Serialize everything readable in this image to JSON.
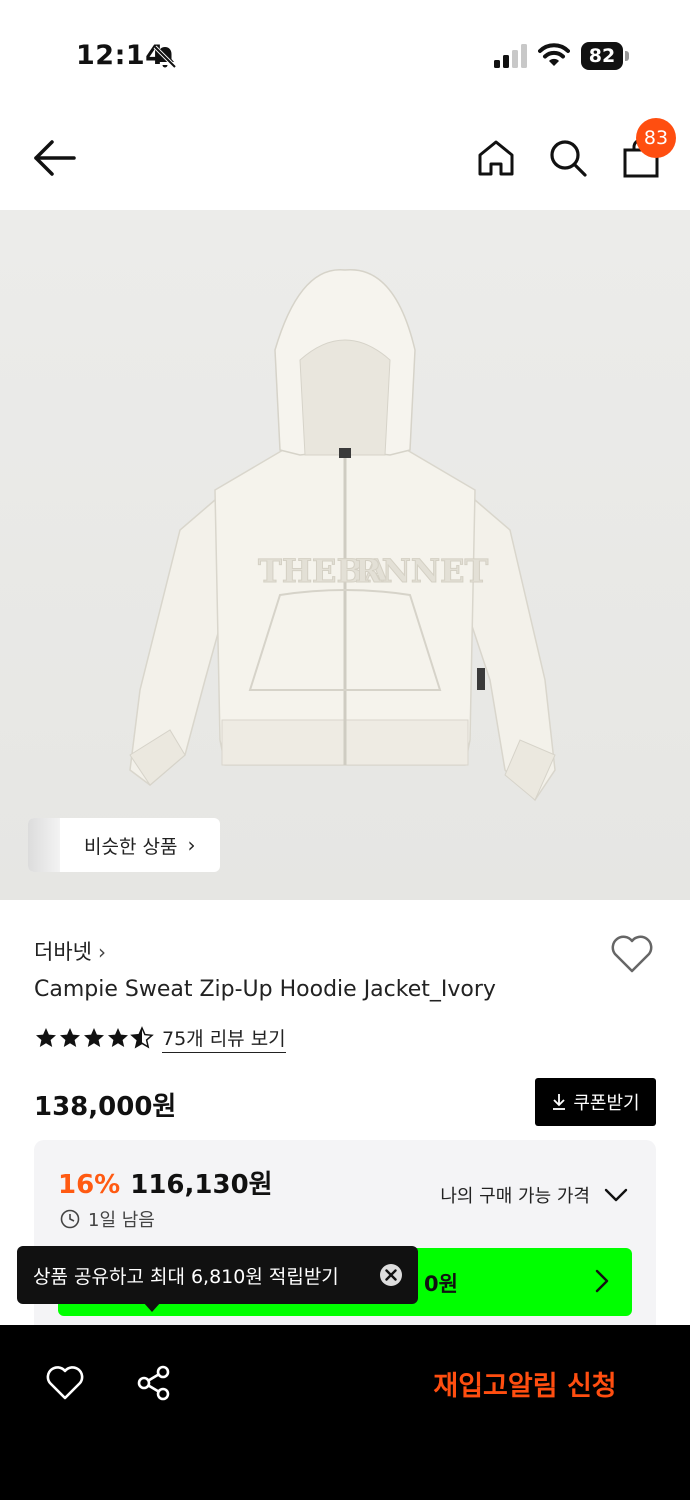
{
  "status_bar": {
    "time": "12:14",
    "battery": "82"
  },
  "header": {
    "cart_count": "83"
  },
  "image": {
    "similar_label": "비슷한 상품"
  },
  "product": {
    "brand": "더바넷",
    "title": "Campie Sweat Zip-Up Hoodie Jacket_Ivory",
    "rating": 4.5,
    "review_link": "75개 리뷰 보기",
    "original_price": "138,000원",
    "coupon_label": "쿠폰받기",
    "discount_rate": "16%",
    "sale_price": "116,130원",
    "time_left": "1일 남음",
    "my_price_label": "나의 구매 가능 가격",
    "green_bar_partial": "0원"
  },
  "tooltip": {
    "text": "상품 공유하고 최대 6,810원 적립받기"
  },
  "bottom_bar": {
    "restock_label": "재입고알림 신청"
  },
  "colors": {
    "accent": "#ff4e10",
    "discount": "#ff5a12",
    "green": "#00ff00"
  }
}
